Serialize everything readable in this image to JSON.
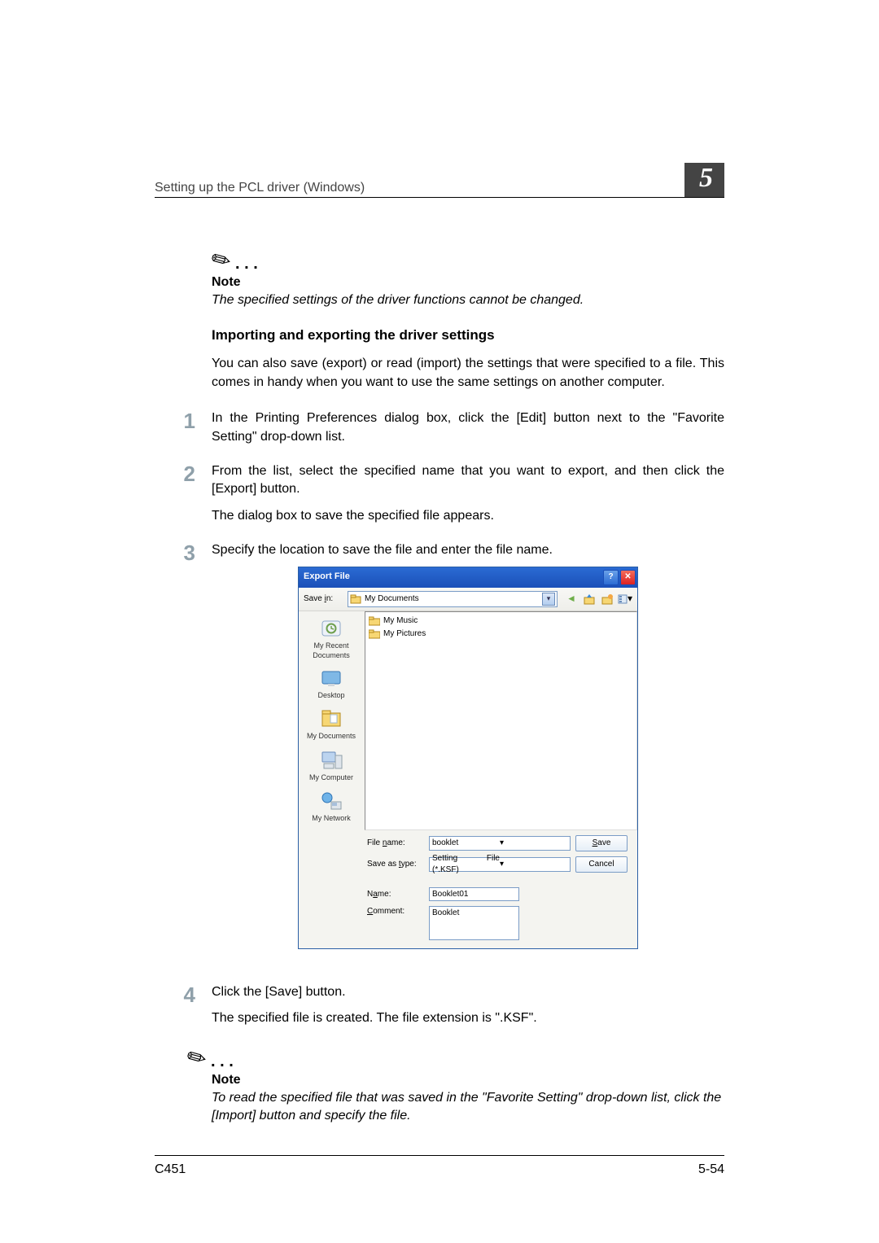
{
  "header": {
    "title": "Setting up the PCL driver (Windows)",
    "chapter": "5"
  },
  "note1": {
    "label": "Note",
    "text": "The specified settings of the driver functions cannot be changed."
  },
  "section": {
    "heading": "Importing and exporting the driver settings",
    "intro": "You can also save (export) or read (import) the settings that were specified to a file. This comes in handy when you want to use the same settings on another computer."
  },
  "steps": {
    "s1": "In the Printing Preferences dialog box, click the [Edit] button next to the \"Favorite Setting\" drop-down list.",
    "s2": "From the list, select the specified name that you want to export, and then click the [Export] button.",
    "s2sub": "The dialog box to save the specified file appears.",
    "s3": "Specify the location to save the file and enter the file name.",
    "s4": "Click the [Save] button.",
    "s4sub": "The specified file is created. The file extension is \".KSF\"."
  },
  "dialog": {
    "title": "Export File",
    "toolbar": {
      "savein_label": "Save in:",
      "location": "My Documents"
    },
    "places": {
      "recent": "My Recent Documents",
      "desktop": "Desktop",
      "mydocs": "My Documents",
      "mycomputer": "My Computer",
      "mynetwork": "My Network"
    },
    "filepane": {
      "f1": "My Music",
      "f2": "My Pictures"
    },
    "form": {
      "filename_label": "File name:",
      "filename_value": "booklet",
      "savetype_label": "Save as type:",
      "savetype_value": "Setting File (*.KSF)",
      "name_label": "Name:",
      "name_value": "Booklet01",
      "comment_label": "Comment:",
      "comment_value": "Booklet",
      "save_btn": "Save",
      "cancel_btn": "Cancel"
    }
  },
  "note2": {
    "label": "Note",
    "text": "To read the specified file that was saved in the \"Favorite Setting\" drop-down list, click the [Import] button and specify the file."
  },
  "footer": {
    "left": "C451",
    "right": "5-54"
  }
}
